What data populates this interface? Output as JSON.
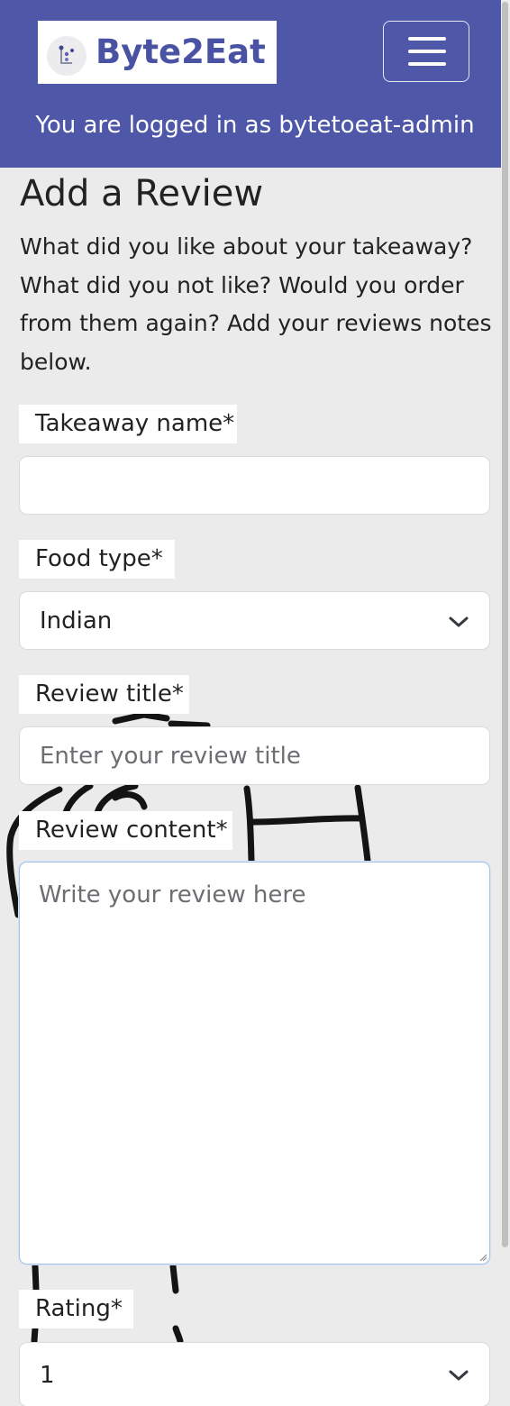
{
  "header": {
    "brand": "Byte2Eat",
    "login_status": "You are logged in as bytetoeat-admin"
  },
  "main": {
    "title": "Add a Review",
    "intro": "What did you like about your takeaway? What did you not like? Would you order from them again? Add your reviews notes below."
  },
  "form": {
    "takeaway_name": {
      "label": "Takeaway name*",
      "value": ""
    },
    "food_type": {
      "label": "Food type*",
      "selected": "Indian"
    },
    "review_title": {
      "label": "Review title*",
      "placeholder": "Enter your review title"
    },
    "review_content": {
      "label": "Review content*",
      "placeholder": "Write your review here"
    },
    "rating": {
      "label": "Rating*",
      "selected": "1"
    }
  },
  "icons": {
    "menu": "hamburger-icon",
    "select_arrow": "chevron-down-icon"
  },
  "colors": {
    "navbar": "#4e57a8",
    "brand_text": "#4a53a3",
    "page_background": "#ebebeb",
    "focus_border": "#a9c3e6"
  }
}
